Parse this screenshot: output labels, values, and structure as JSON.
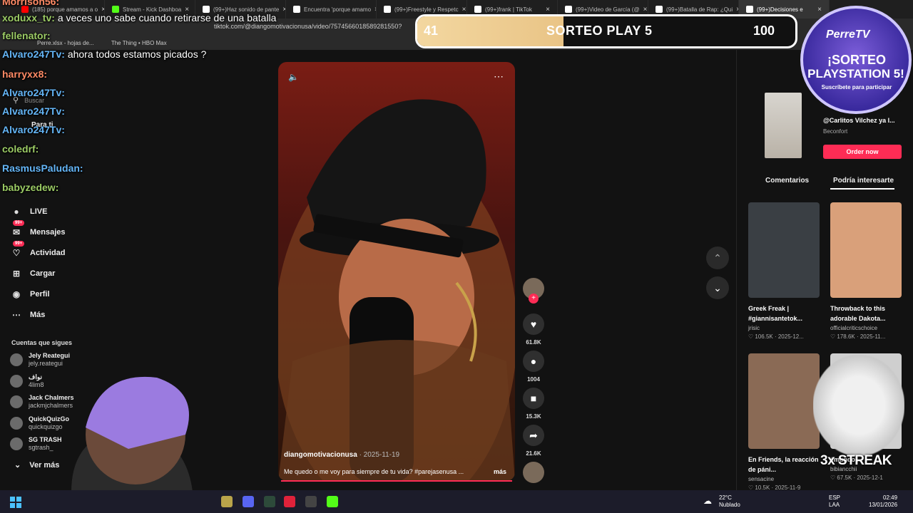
{
  "browser": {
    "tabs": [
      {
        "label": "(185) porque amamos a o",
        "color": "#ff0000",
        "active": false
      },
      {
        "label": "Stream - Kick Dashboa",
        "color": "#53fc18",
        "active": false
      },
      {
        "label": "(99+)Haz sonido de pante",
        "color": "#ffffff",
        "active": false
      },
      {
        "label": "Encuentra 'porque amamo",
        "color": "#ffffff",
        "active": false
      },
      {
        "label": "(99+)Freestyle y Respetc",
        "color": "#ffffff",
        "active": false
      },
      {
        "label": "(99+)frank | TikTok",
        "color": "#ffffff",
        "active": false
      },
      {
        "label": "(99+)Video de García (@",
        "color": "#ffffff",
        "active": false
      },
      {
        "label": "(99+)Batalla de Rap: ¿Qui",
        "color": "#ffffff",
        "active": false
      },
      {
        "label": "(99+)Decisiones e",
        "color": "#ffffff",
        "active": true
      }
    ],
    "url": "tiktok.com/@diangomotivacionusa/video/7574566018589281550?",
    "bookmarks": [
      "Perre.xlsx - hojas de...",
      "The Thing • HBO Max"
    ]
  },
  "chat": [
    {
      "user": "Morrison56:",
      "msg": "",
      "userClass": "u3"
    },
    {
      "user": "xoduxx_tv:",
      "msg": "a veces uno sabe cuando retirarse de una batalla",
      "userClass": "u2"
    },
    {
      "user": "fellenator:",
      "msg": "",
      "userClass": "u2"
    },
    {
      "user": "Alvaro247Tv:",
      "msg": "ahora todos estamos picados ?",
      "userClass": "u1"
    },
    {
      "user": "harryxx8:",
      "msg": "",
      "userClass": "u3"
    },
    {
      "user": "Alvaro247Tv:",
      "msg": "",
      "userClass": "u1"
    },
    {
      "user": "Alvaro247Tv:",
      "msg": "",
      "userClass": "u1"
    },
    {
      "user": "Alvaro247Tv:",
      "msg": "",
      "userClass": "u1"
    },
    {
      "user": "coledrf:",
      "msg": "",
      "userClass": "u2"
    },
    {
      "user": "RasmusPaludan:",
      "msg": "",
      "userClass": "u1"
    },
    {
      "user": "babyzedew:",
      "msg": "",
      "userClass": "u2"
    }
  ],
  "sidebar": {
    "search_placeholder": "Buscar",
    "para_ti": "Para ti",
    "nav": [
      {
        "label": "LIVE",
        "icon": "live-icon",
        "badge": ""
      },
      {
        "label": "Mensajes",
        "icon": "message-icon",
        "badge": "99+"
      },
      {
        "label": "Actividad",
        "icon": "activity-icon",
        "badge": "99+"
      },
      {
        "label": "Cargar",
        "icon": "upload-icon",
        "badge": ""
      },
      {
        "label": "Perfil",
        "icon": "profile-icon",
        "badge": ""
      },
      {
        "label": "Más",
        "icon": "more-icon",
        "badge": ""
      }
    ],
    "following_title": "Cuentas que sigues",
    "following": [
      {
        "name": "Jely Reategui",
        "handle": "jely.reategui"
      },
      {
        "name": "نواف",
        "handle": "4lim8"
      },
      {
        "name": "Jack Chalmers",
        "handle": "jackmjchalmers"
      },
      {
        "name": "QuickQuizGo",
        "handle": "quickquizgo"
      },
      {
        "name": "SG TRASH",
        "handle": "sgtrash_"
      }
    ],
    "ver_mas": "Ver más"
  },
  "video": {
    "author": "diangomotivacionusa",
    "date": "· 2025-11-19",
    "caption": "Me quedo o me voy para siempre de tu vida? #parejasenusa ...",
    "more": "más",
    "progress": 1.0,
    "actions": [
      {
        "icon": "heart-icon",
        "count": "61.8K"
      },
      {
        "icon": "comment-icon",
        "count": "1004"
      },
      {
        "icon": "bookmark-icon",
        "count": "15.3K"
      },
      {
        "icon": "share-icon",
        "count": "21.6K"
      }
    ]
  },
  "ad": {
    "title": "@Carlitos Vilchez ya l...",
    "sub": "Beconfort",
    "button": "Order now"
  },
  "right_tabs": [
    "Comentarios",
    "Podría interesarte"
  ],
  "cards": [
    {
      "title": "Greek Freak | #giannisantetok...",
      "author": "jrisic",
      "stats": "♡ 106.5K · 2025-12...",
      "thumb": "#3a3f44"
    },
    {
      "title": "Throwback to this adorable Dakota...",
      "author": "officialcriticschoice",
      "stats": "♡ 178.6K · 2025-11...",
      "thumb": "#d9a07a"
    },
    {
      "title": "En Friends, la reacción de páni...",
      "author": "sensacine",
      "stats": "♡ 10.5K · 2025-11-9",
      "thumb": "#8a6a55"
    },
    {
      "title": "#mundo...",
      "author": "bibiancchii",
      "stats": "♡ 67.5K · 2025-12-1",
      "thumb": "#cfcfcf"
    }
  ],
  "sorteo": {
    "left": "41",
    "center": "SORTEO PLAY 5",
    "right": "100",
    "progress": 0.41
  },
  "logo": {
    "name": "PerreTV",
    "line1": "¡SORTEO",
    "line2": "PLAYSTATION 5!",
    "sub": "Suscríbete para participar"
  },
  "streak": "3x STREAK",
  "taskbar": {
    "temp": "22°C",
    "weather": "Nublado",
    "lang1": "ESP",
    "lang2": "LAA",
    "time": "02:49",
    "date": "13/01/2026"
  },
  "colors": {
    "accent": "#fe2c55",
    "panel": "#121212",
    "sorteo_fill": "#f3d7a0"
  }
}
